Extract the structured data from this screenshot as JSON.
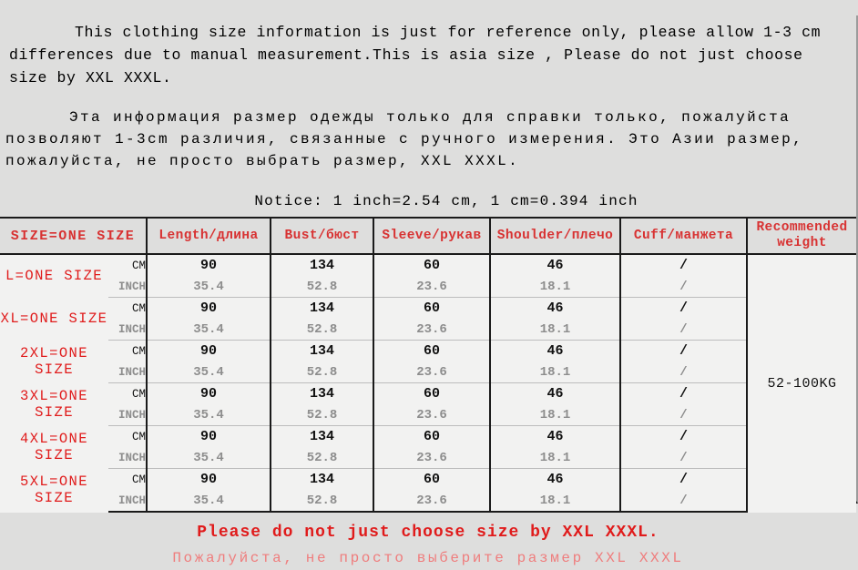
{
  "intro": {
    "english": "This clothing size information is just for reference only, please allow 1-3 cm differences due to manual measurement.This is asia size , Please do not just choose size by XXL XXXL.",
    "russian": "Эта информация размер одежды только для справки только, пожалуйста позволяют 1-3cm различия, связанные с ручного измерения. Это Азии размер, пожалуйста, не просто выбрать размер, XXL XXXL.",
    "notice": "Notice: 1 inch=2.54 cm, 1 cm=0.394 inch"
  },
  "table": {
    "headers": {
      "size": "SIZE=ONE SIZE",
      "length": "Length/длина",
      "bust": "Bust/бюст",
      "sleeve": "Sleeve/рукав",
      "shoulder": "Shoulder/плечо",
      "cuff": "Cuff/манжета",
      "weight": "Recommended weight"
    },
    "unit_labels": {
      "cm": "CM",
      "inch": "INCH"
    },
    "recommended_weight": "52-100KG",
    "rows": [
      {
        "size": "L=ONE SIZE",
        "cm": {
          "length": "90",
          "bust": "134",
          "sleeve": "60",
          "shoulder": "46",
          "cuff": "/"
        },
        "inch": {
          "length": "35.4",
          "bust": "52.8",
          "sleeve": "23.6",
          "shoulder": "18.1",
          "cuff": "/"
        }
      },
      {
        "size": "XL=ONE SIZE",
        "cm": {
          "length": "90",
          "bust": "134",
          "sleeve": "60",
          "shoulder": "46",
          "cuff": "/"
        },
        "inch": {
          "length": "35.4",
          "bust": "52.8",
          "sleeve": "23.6",
          "shoulder": "18.1",
          "cuff": "/"
        }
      },
      {
        "size": "2XL=ONE SIZE",
        "cm": {
          "length": "90",
          "bust": "134",
          "sleeve": "60",
          "shoulder": "46",
          "cuff": "/"
        },
        "inch": {
          "length": "35.4",
          "bust": "52.8",
          "sleeve": "23.6",
          "shoulder": "18.1",
          "cuff": "/"
        }
      },
      {
        "size": "3XL=ONE SIZE",
        "cm": {
          "length": "90",
          "bust": "134",
          "sleeve": "60",
          "shoulder": "46",
          "cuff": "/"
        },
        "inch": {
          "length": "35.4",
          "bust": "52.8",
          "sleeve": "23.6",
          "shoulder": "18.1",
          "cuff": "/"
        }
      },
      {
        "size": "4XL=ONE SIZE",
        "cm": {
          "length": "90",
          "bust": "134",
          "sleeve": "60",
          "shoulder": "46",
          "cuff": "/"
        },
        "inch": {
          "length": "35.4",
          "bust": "52.8",
          "sleeve": "23.6",
          "shoulder": "18.1",
          "cuff": "/"
        }
      },
      {
        "size": "5XL=ONE SIZE",
        "cm": {
          "length": "90",
          "bust": "134",
          "sleeve": "60",
          "shoulder": "46",
          "cuff": "/"
        },
        "inch": {
          "length": "35.4",
          "bust": "52.8",
          "sleeve": "23.6",
          "shoulder": "18.1",
          "cuff": "/"
        }
      }
    ]
  },
  "footer": {
    "english": "Please do not just choose size by XXL XXXL.",
    "russian": "Пожалуйста, не просто выберите размер XXL XXXL"
  },
  "colors": {
    "page_background": "#dededd",
    "table_background": "#f2f2f1",
    "header_text": "#d83232",
    "size_label_text": "#e01b1b",
    "cm_value_text": "#111111",
    "inch_value_text": "#8d8d8d",
    "footer_en_text": "#e01b1b",
    "footer_ru_text": "#ef7d7d",
    "border": "#1a1a1a"
  }
}
